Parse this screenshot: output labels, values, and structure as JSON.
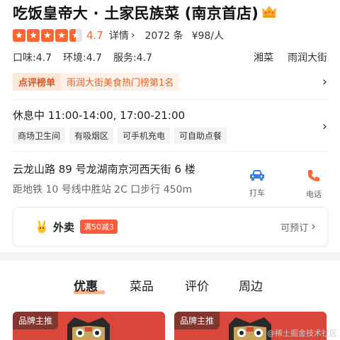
{
  "header": {
    "title": "吃饭皇帝大 · 土家民族菜 (南京首店)",
    "crown_icon": "crown-icon"
  },
  "rating": {
    "stars": 4.5,
    "score": "4.7",
    "detail_label": "详情",
    "review_count": "2072 条",
    "avg_price": "¥98/人"
  },
  "scores": {
    "taste": "口味:4.7",
    "environment": "环境:4.7",
    "service": "服务:4.7",
    "cuisine": "湘菜",
    "area": "雨润大街"
  },
  "ranking": {
    "badge": "点评榜单",
    "text": "雨润大街美食热门榜第1名"
  },
  "hours": {
    "text": "休息中 11:00-14:00, 17:00-21:00",
    "tags": [
      "商场卫生间",
      "有吸烟区",
      "可手机充电",
      "可自助点餐"
    ]
  },
  "location": {
    "address": "云龙山路 89 号龙湖南京河西天街 6 楼",
    "metro": "距地铁 10 号线中胜站 2C 口步行 450m",
    "taxi_label": "打车",
    "phone_label": "电话"
  },
  "takeout": {
    "label": "外卖",
    "promo": "满50减3",
    "reserve": "可预订"
  },
  "tabs": [
    {
      "label": "优惠",
      "active": true
    },
    {
      "label": "菜品",
      "active": false
    },
    {
      "label": "评价",
      "active": false
    },
    {
      "label": "周边",
      "active": false
    }
  ],
  "promo_cards": [
    {
      "badge": "品牌主推"
    },
    {
      "badge": "品牌主推"
    }
  ],
  "watermark": "@稀土掘金技术社区",
  "colors": {
    "accent": "#ff6633",
    "taxi_icon": "#3d7fe0",
    "phone_icon": "#ff6633",
    "promo_card": "#d9473a"
  }
}
